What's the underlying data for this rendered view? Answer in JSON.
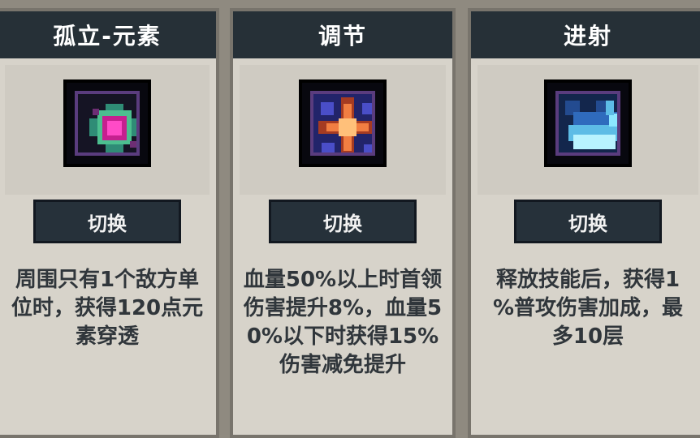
{
  "cards": [
    {
      "title": "孤立-元素",
      "button_label": "切换",
      "description": "周围只有1个敌方单\n位时，获得120点元\n素穿透",
      "icon": "pink-gem-icon"
    },
    {
      "title": "调节",
      "button_label": "切换",
      "description": "血量50%以上时首领\n伤害提升8%，血量5\n0%以下时获得15%\n伤害减免提升",
      "icon": "cross-spark-icon"
    },
    {
      "title": "进射",
      "button_label": "切换",
      "description": "释放技能后，获得1\n%普攻伤害加成，最\n多10层",
      "icon": "ice-blast-icon"
    }
  ],
  "colors": {
    "header": "#263037",
    "card_bg": "#d7d3ca",
    "button_bg": "#26313a",
    "text": "#30363b"
  }
}
